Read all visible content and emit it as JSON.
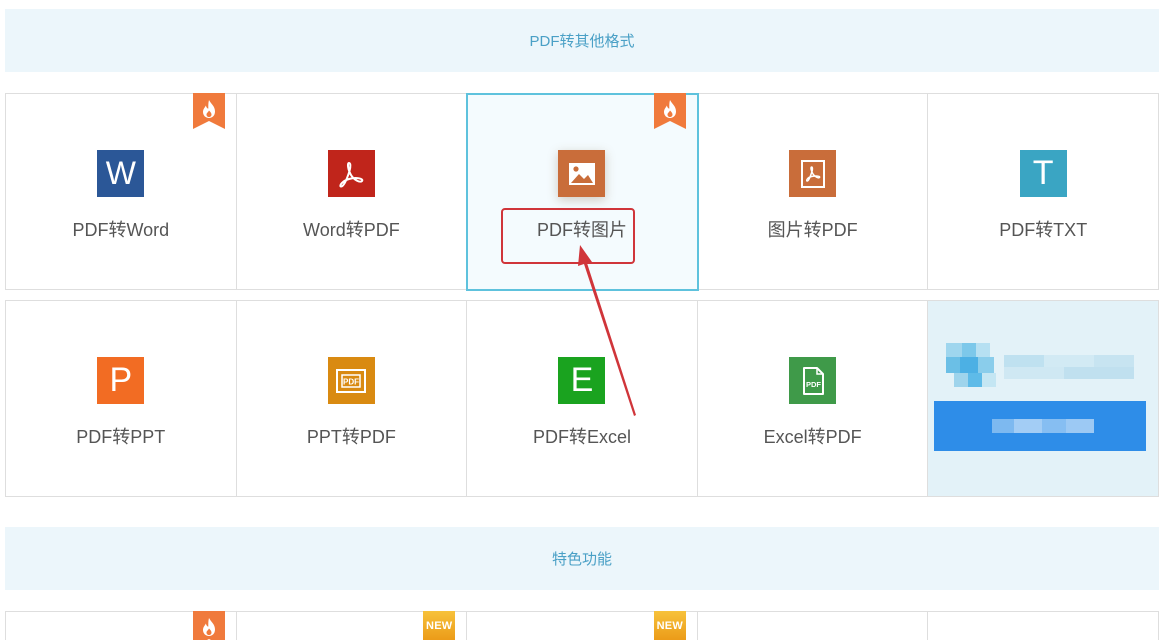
{
  "sections": [
    {
      "title": "PDF转其他格式"
    },
    {
      "title": "特色功能"
    }
  ],
  "tools_row1": [
    {
      "label": "PDF转Word",
      "icon": "word-icon",
      "color": "#2b5797",
      "badge": "hot"
    },
    {
      "label": "Word转PDF",
      "icon": "acrobat-icon",
      "color": "#c0251b"
    },
    {
      "label": "PDF转图片",
      "icon": "image-icon",
      "color": "#c96d3a",
      "badge": "hot",
      "selected": true
    },
    {
      "label": "图片转PDF",
      "icon": "pdf-doc-icon",
      "color": "#c96d3a"
    },
    {
      "label": "PDF转TXT",
      "icon": "text-icon",
      "color": "#3aa5c3"
    }
  ],
  "tools_row2": [
    {
      "label": "PDF转PPT",
      "icon": "powerpoint-icon",
      "color": "#f26c23"
    },
    {
      "label": "PPT转PDF",
      "icon": "ppt-pdf-icon",
      "color": "#d98a11"
    },
    {
      "label": "PDF转Excel",
      "icon": "excel-icon",
      "color": "#1aa31f"
    },
    {
      "label": "Excel转PDF",
      "icon": "excel-pdf-icon",
      "color": "#3f9a49"
    }
  ],
  "icon_glyphs": {
    "word": "W",
    "text": "T",
    "powerpoint": "P",
    "excel": "E",
    "pdf_small": "PDF"
  },
  "badges": {
    "new": "NEW"
  },
  "tools_row3_badges": [
    "hot",
    "new",
    "new",
    "",
    ""
  ],
  "colors": {
    "header_bg": "#ecf6fb",
    "header_text": "#4aa0c6",
    "selected_border": "#5ec2dd",
    "hot_ribbon": "#f07a3c",
    "annotation": "#d0353a"
  }
}
